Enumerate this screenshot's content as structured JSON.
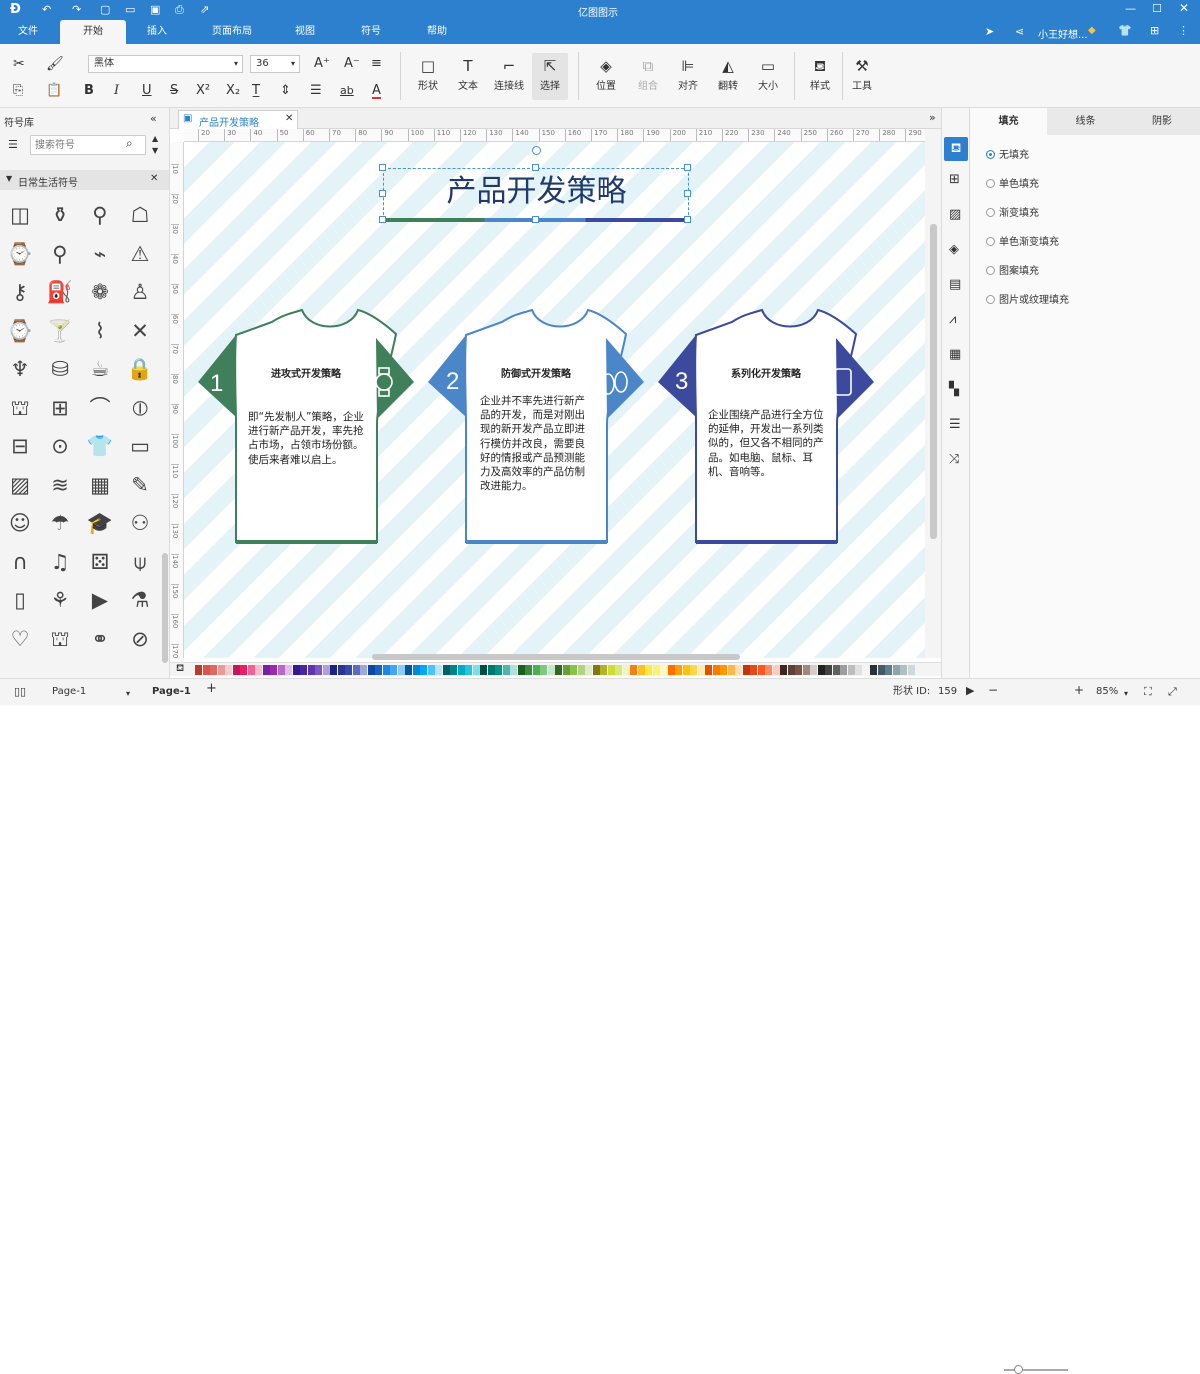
{
  "app": {
    "title": "亿图图示",
    "user": "小王好想..."
  },
  "menu": {
    "file": "文件",
    "tabs": [
      "开始",
      "插入",
      "页面布局",
      "视图",
      "符号",
      "帮助"
    ]
  },
  "ribbon": {
    "font_family": "黑体",
    "font_size": "36",
    "buttons": {
      "shape": "形状",
      "text": "文本",
      "connector": "连接线",
      "select": "选择",
      "position": "位置",
      "group": "组合",
      "align": "对齐",
      "flip": "翻转",
      "size": "大小",
      "style": "样式",
      "tools": "工具"
    }
  },
  "library": {
    "title": "符号库",
    "search_placeholder": "搜索符号",
    "category": "日常生活符号"
  },
  "document": {
    "tab_name": "产品开发策略"
  },
  "ruler": {
    "top": [
      "20",
      "30",
      "40",
      "50",
      "60",
      "70",
      "80",
      "90",
      "100",
      "110",
      "120",
      "130",
      "140",
      "150",
      "160",
      "170",
      "180",
      "190",
      "200",
      "210",
      "220",
      "230",
      "240",
      "250",
      "260",
      "270",
      "280",
      "290"
    ],
    "left": [
      "10",
      "20",
      "30",
      "40",
      "50",
      "60",
      "70",
      "80",
      "90",
      "100",
      "110",
      "120",
      "130",
      "140",
      "150",
      "160",
      "170"
    ]
  },
  "diagram": {
    "title": "产品开发策略",
    "shirts": [
      {
        "number": "1",
        "title": "进攻式开发策略",
        "text": "即“先发制人”策略，企业进行新产品开发，率先抢占市场，占领市场份额。使后来者难以启上。",
        "color": "#3f7f5a",
        "icon": "watch-icon"
      },
      {
        "number": "2",
        "title": "防御式开发策略",
        "text": "企业并不率先进行新产品的开发，而是对刚出现的新开发产品立即进行模仿并改良，需要良好的情报或产品预测能力及高效率的产品仿制改进能力。",
        "color": "#4a86c8",
        "icon": "slippers-icon"
      },
      {
        "number": "3",
        "title": "系列化开发策略",
        "text": "企业围绕产品进行全方位的延伸，开发出一系列类似的，但又各不相同的产品。如电脑、鼠标、耳机、音响等。",
        "color": "#3b4a9c",
        "icon": "phone-icon"
      }
    ]
  },
  "right_panel": {
    "tabs": [
      "填充",
      "线条",
      "阴影"
    ],
    "fill_options": [
      "无填充",
      "单色填充",
      "渐变填充",
      "单色渐变填充",
      "图案填充",
      "图片或纹理填充"
    ],
    "selected_fill": "无填充"
  },
  "status": {
    "page_selector": "Page-1",
    "page_tab": "Page-1",
    "shape_id_label": "形状 ID:",
    "shape_id": "159",
    "zoom": "85%"
  },
  "palette": [
    "#c0392b",
    "#d9534f",
    "#e06666",
    "#ea9999",
    "#f4cccc",
    "#c2185b",
    "#e91e63",
    "#f06292",
    "#f8bbd0",
    "#7b1fa2",
    "#9c27b0",
    "#ba68c8",
    "#e1bee7",
    "#311b92",
    "#4527a0",
    "#5e35b1",
    "#7e57c2",
    "#b39ddb",
    "#1a237e",
    "#283593",
    "#3949ab",
    "#5c6bc0",
    "#9fa8da",
    "#0d47a1",
    "#1565c0",
    "#1e88e5",
    "#42a5f5",
    "#90caf9",
    "#01579b",
    "#0288d1",
    "#03a9f4",
    "#4fc3f7",
    "#b3e5fc",
    "#006064",
    "#00838f",
    "#00acc1",
    "#26c6da",
    "#80deea",
    "#004d40",
    "#00796b",
    "#009688",
    "#4db6ac",
    "#b2dfdb",
    "#1b5e20",
    "#388e3c",
    "#4caf50",
    "#81c784",
    "#c8e6c9",
    "#33691e",
    "#689f38",
    "#8bc34a",
    "#aed581",
    "#dcedc8",
    "#827717",
    "#afb42b",
    "#cddc39",
    "#dce775",
    "#f0f4c3",
    "#f57f17",
    "#fbc02d",
    "#ffeb3b",
    "#fff176",
    "#fff9c4",
    "#ff6f00",
    "#ffa000",
    "#ffc107",
    "#ffd54f",
    "#ffecb3",
    "#e65100",
    "#f57c00",
    "#ff9800",
    "#ffb74d",
    "#ffe0b2",
    "#bf360c",
    "#e64a19",
    "#ff5722",
    "#ff8a65",
    "#ffccbc",
    "#3e2723",
    "#5d4037",
    "#795548",
    "#a1887f",
    "#d7ccc8",
    "#212121",
    "#424242",
    "#616161",
    "#9e9e9e",
    "#bdbdbd",
    "#e0e0e0",
    "#f5f5f5",
    "#263238",
    "#455a64",
    "#607d8b",
    "#90a4ae",
    "#b0bec5",
    "#cfd8dc"
  ]
}
